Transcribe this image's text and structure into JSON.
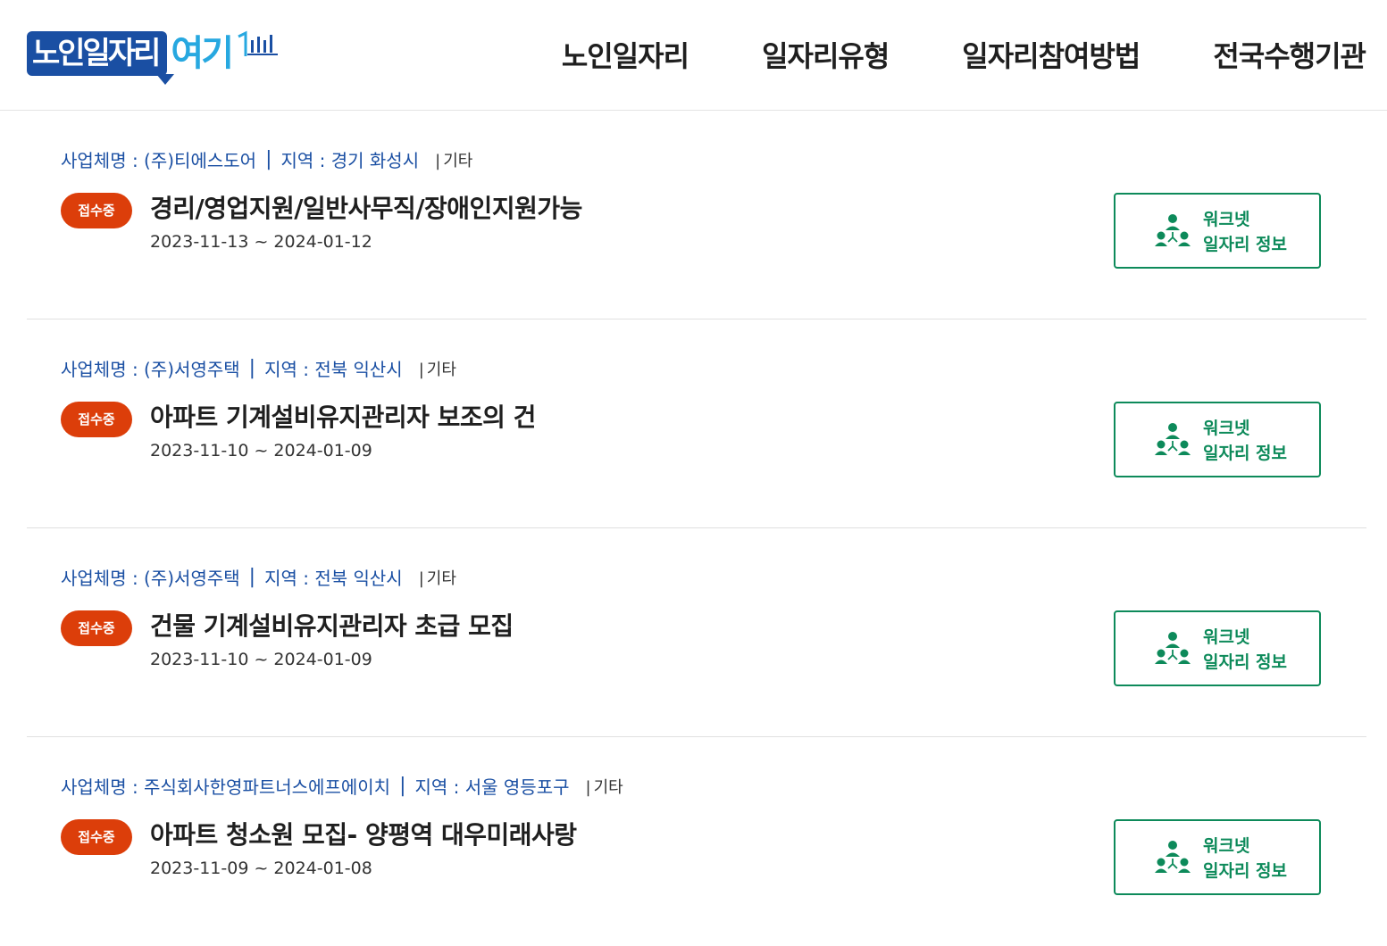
{
  "header": {
    "logo_main": "노인일자리",
    "logo_accent": "여기",
    "nav": [
      {
        "label": "노인일자리"
      },
      {
        "label": "일자리유형"
      },
      {
        "label": "일자리참여방법"
      },
      {
        "label": "전국수행기관"
      }
    ]
  },
  "colors": {
    "brand_blue": "#1a4fa3",
    "accent_cyan": "#27a8e0",
    "badge_orange": "#dc3e0a",
    "worknet_green": "#0d8a5a"
  },
  "jobs": [
    {
      "company": "사업체명 : (주)티에스도어",
      "region": "지역 : 경기 화성시",
      "category": "기타",
      "status": "접수중",
      "title": "경리/영업지원/일반사무직/장애인지원가능",
      "period": "2023-11-13 ~ 2024-01-12",
      "btn_line1": "워크넷",
      "btn_line2": "일자리 정보"
    },
    {
      "company": "사업체명 : (주)서영주택",
      "region": "지역 : 전북 익산시",
      "category": "기타",
      "status": "접수중",
      "title": "아파트 기계설비유지관리자 보조의 건",
      "period": "2023-11-10 ~ 2024-01-09",
      "btn_line1": "워크넷",
      "btn_line2": "일자리 정보"
    },
    {
      "company": "사업체명 : (주)서영주택",
      "region": "지역 : 전북 익산시",
      "category": "기타",
      "status": "접수중",
      "title": "건물 기계설비유지관리자 초급 모집",
      "period": "2023-11-10 ~ 2024-01-09",
      "btn_line1": "워크넷",
      "btn_line2": "일자리 정보"
    },
    {
      "company": "사업체명 : 주식회사한영파트너스에프에이치",
      "region": "지역 : 서울 영등포구",
      "category": "기타",
      "status": "접수중",
      "title": "아파트 청소원 모집- 양평역 대우미래사랑",
      "period": "2023-11-09 ~ 2024-01-08",
      "btn_line1": "워크넷",
      "btn_line2": "일자리 정보"
    }
  ]
}
